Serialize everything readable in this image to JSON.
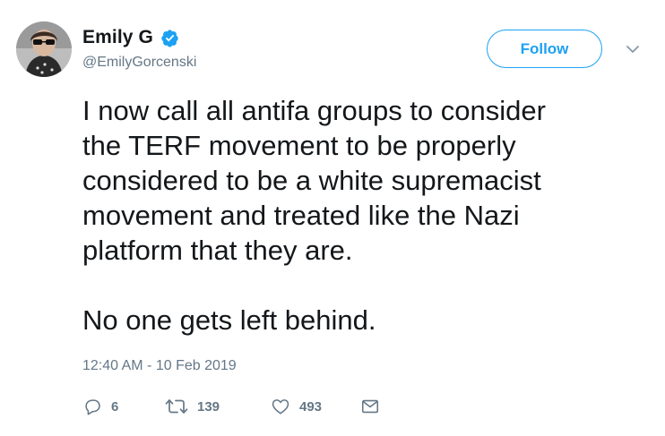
{
  "user": {
    "display_name": "Emily G",
    "handle": "@EmilyGorcenski",
    "verified": true
  },
  "follow_button": {
    "label": "Follow"
  },
  "tweet": {
    "lines": [
      "I now call all antifa groups to consider",
      "the TERF movement to be properly",
      "considered to be a white supremacist",
      "movement and treated like the Nazi",
      "platform that they are."
    ],
    "closing": "No one gets left behind.",
    "timestamp": "12:40 AM - 10 Feb 2019"
  },
  "actions": {
    "replies": "6",
    "retweets": "139",
    "likes": "493"
  },
  "icons": {
    "verified": "verified-badge-icon",
    "menu": "chevron-down-icon",
    "reply": "reply-icon",
    "retweet": "retweet-icon",
    "like": "heart-icon",
    "message": "envelope-icon"
  },
  "colors": {
    "accent": "#1da1f2",
    "text": "#14171a",
    "secondary": "#657786"
  }
}
